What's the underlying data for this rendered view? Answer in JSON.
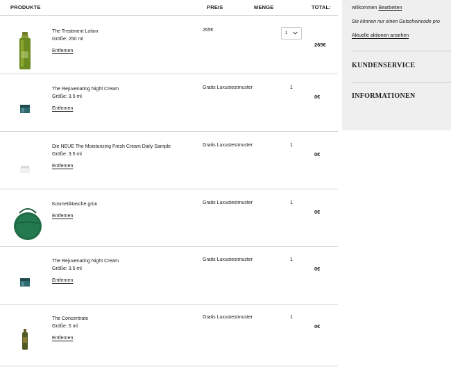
{
  "table": {
    "headers": {
      "product": "PRODUKTE",
      "price": "PREIS",
      "quantity": "MENGE",
      "total": "TOTAL:"
    },
    "items": [
      {
        "name": "The Treatment Lotion",
        "size": "Größe: 250 ml",
        "remove": "Entfernen",
        "price": "265€",
        "quantity": "1",
        "total": "265€",
        "thumb": "green-bottle"
      },
      {
        "name": "The Rejuvenating Night Cream",
        "size": "Größe: 3.5 ml",
        "remove": "Entfernen",
        "price": "Gratis Luxustestmuster",
        "quantity": "1",
        "total": "0€",
        "thumb": "teal-jar"
      },
      {
        "name": "Die NEUE The Moisturizing Fresh Cream Daily Sample",
        "size": "Größe: 3.5 ml",
        "remove": "Entfernen",
        "price": "Gratis Luxustestmuster",
        "quantity": "1",
        "total": "0€",
        "thumb": "white-jar"
      },
      {
        "name": "Kosmetiktasche grün",
        "size": "",
        "remove": "Entfernen",
        "price": "Gratis Luxustestmuster",
        "quantity": "1",
        "total": "0€",
        "thumb": "green-pouch"
      },
      {
        "name": "The Rejuvenating Night Cream",
        "size": "Größe: 3.5 ml",
        "remove": "Entfernen",
        "price": "Gratis Luxustestmuster",
        "quantity": "1",
        "total": "0€",
        "thumb": "teal-jar"
      },
      {
        "name": "The Concentrate",
        "size": "Größe: 5 ml",
        "remove": "Entfernen",
        "price": "Gratis Luxustestmuster",
        "quantity": "1",
        "total": "0€",
        "thumb": "small-green-bottle"
      }
    ]
  },
  "sidebar": {
    "welcome": "willkommen",
    "edit": "Bearbeiten",
    "coupon_note": "Sie können nur einen Gutscheincode pro",
    "current_promos": "Aktuelle aktionen ansehen",
    "customer_service": "KUNDENSERVICE",
    "information": "INFORMATIONEN"
  },
  "colors": {
    "sidebar_bg": "#efefef",
    "divider": "#d6d6d6",
    "text": "#1a1a1a"
  }
}
